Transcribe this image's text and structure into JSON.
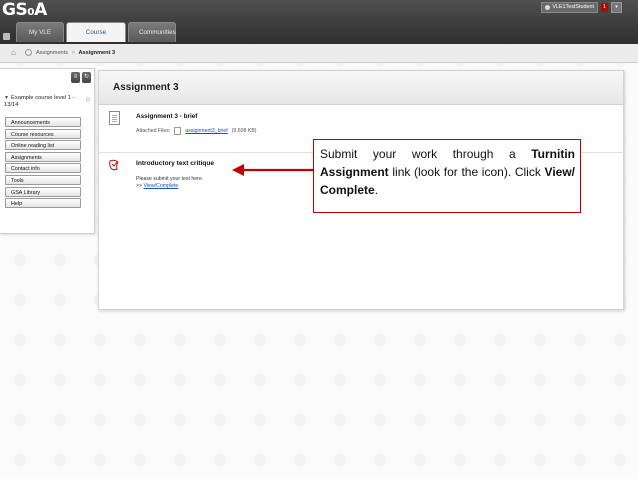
{
  "brand": {
    "logo_text": "GS₀A"
  },
  "user": {
    "name_label": "VLE1TestStudent",
    "notifications": "1",
    "menu_icon": "chevron-down-icon"
  },
  "tabs": [
    {
      "label": "My VLE",
      "active": false
    },
    {
      "label": "Course Catalogue",
      "active": true
    },
    {
      "label": "Communities",
      "active": false
    }
  ],
  "breadcrumb": {
    "items": [
      "Assignments",
      "Assignment 3"
    ],
    "separator": ">"
  },
  "sidebar": {
    "course_title": "Example course level 1 - 13/14",
    "menu_items": [
      "Announcements",
      "Course resources",
      "Online reading list",
      "Assignments",
      "Contact info",
      "Tools",
      "GSA Library",
      "Help"
    ]
  },
  "content": {
    "page_title": "Assignment 3",
    "item1": {
      "title": "Assignment 3 - brief",
      "attached_label": "Attached Files:",
      "file_name": "assignment3_brief",
      "file_size": "(9.608 KB)"
    },
    "item2": {
      "title": "Introductory text critique",
      "description": "Please submit your text here.",
      "link_prefix": ">>",
      "link_label": "View/Complete"
    }
  },
  "callout": {
    "part1": "Submit your work through a ",
    "bold1": "Turnitin Assignment",
    "part2": " link (look for the icon). Click ",
    "bold2": "View/ Complete",
    "part3": "."
  },
  "colors": {
    "accent_red": "#c00000",
    "link_blue": "#1a55b0",
    "topbar": "#3a3a3a"
  }
}
